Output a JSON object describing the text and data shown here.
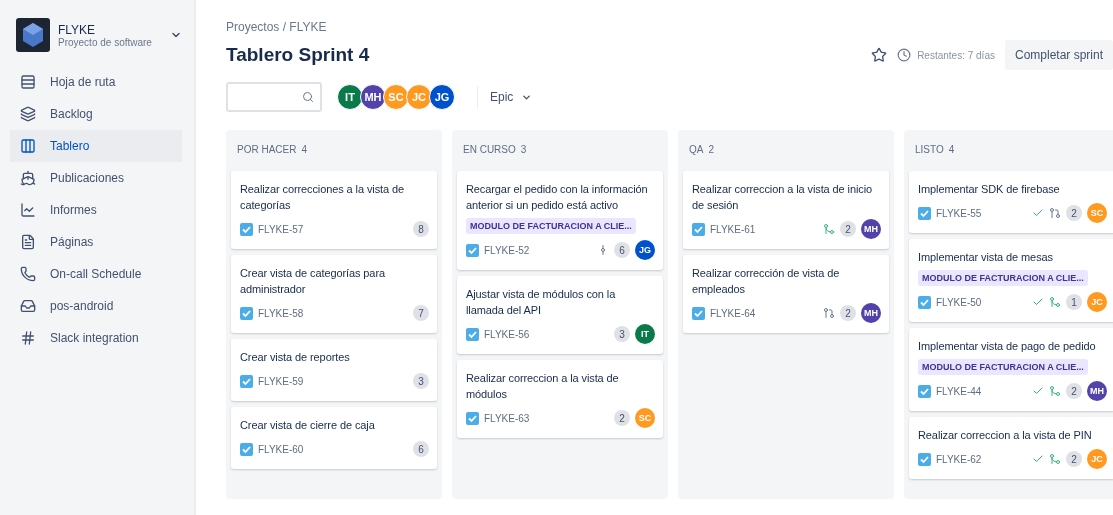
{
  "sidebar": {
    "project": {
      "name": "FLYKE",
      "type": "Proyecto de software"
    },
    "items": [
      {
        "label": "Hoja de ruta",
        "kind": "roadmap",
        "selected": false
      },
      {
        "label": "Backlog",
        "kind": "backlog",
        "selected": false
      },
      {
        "label": "Tablero",
        "kind": "board",
        "selected": true
      },
      {
        "label": "Publicaciones",
        "kind": "releases",
        "selected": false
      },
      {
        "label": "Informes",
        "kind": "reports",
        "selected": false
      },
      {
        "label": "Páginas",
        "kind": "pages",
        "selected": false
      },
      {
        "label": "On-call Schedule",
        "kind": "oncall",
        "selected": false
      },
      {
        "label": "pos-android",
        "kind": "repo",
        "selected": false
      },
      {
        "label": "Slack integration",
        "kind": "slack",
        "selected": false
      }
    ]
  },
  "header": {
    "breadcrumb": "Proyectos / FLYKE",
    "title": "Tablero Sprint 4",
    "remaining": "Restantes: 7 días",
    "complete_button": "Completar sprint"
  },
  "filters": {
    "avatars": [
      {
        "initials": "IT",
        "color": "#0b7a4b"
      },
      {
        "initials": "MH",
        "color": "#5243aa"
      },
      {
        "initials": "SC",
        "color": "#ff991f"
      },
      {
        "initials": "JC",
        "color": "#ff991f"
      },
      {
        "initials": "JG",
        "color": "#0052cc"
      }
    ],
    "epic_filter": "Epic"
  },
  "columns": [
    {
      "name": "POR HACER",
      "count": "4",
      "cards": [
        {
          "title": "Realizar correcciones a la vista de categorías",
          "key": "FLYKE-57",
          "estimate": "8"
        },
        {
          "title": "Crear vista de categorías para administrador",
          "key": "FLYKE-58",
          "estimate": "7"
        },
        {
          "title": "Crear vista de reportes",
          "key": "FLYKE-59",
          "estimate": "3"
        },
        {
          "title": "Crear vista de cierre de caja",
          "key": "FLYKE-60",
          "estimate": "6"
        }
      ]
    },
    {
      "name": "EN CURSO",
      "count": "3",
      "cards": [
        {
          "title": "Recargar el pedido con la información anterior si un pedido está activo",
          "epic": "MODULO DE FACTURACION A CLIE...",
          "key": "FLYKE-52",
          "badges": [
            {
              "kind": "commit"
            }
          ],
          "estimate": "6",
          "assignee": {
            "initials": "JG",
            "color": "#0052cc"
          }
        },
        {
          "title": "Ajustar vista de módulos con la llamada del API",
          "key": "FLYKE-56",
          "estimate": "3",
          "assignee": {
            "initials": "IT",
            "color": "#0b7a4b"
          }
        },
        {
          "title": "Realizar correccion a la vista de módulos",
          "key": "FLYKE-63",
          "estimate": "2",
          "assignee": {
            "initials": "SC",
            "color": "#ff991f"
          }
        }
      ]
    },
    {
      "name": "QA",
      "count": "2",
      "cards": [
        {
          "title": "Realizar correccion a la vista de inicio de sesión",
          "key": "FLYKE-61",
          "badges": [
            {
              "kind": "merged"
            }
          ],
          "estimate": "2",
          "assignee": {
            "initials": "MH",
            "color": "#5243aa"
          }
        },
        {
          "title": "Realizar corrección de vista de empleados",
          "key": "FLYKE-64",
          "badges": [
            {
              "kind": "open"
            }
          ],
          "estimate": "2",
          "assignee": {
            "initials": "MH",
            "color": "#5243aa"
          }
        }
      ]
    },
    {
      "name": "LISTO",
      "count": "4",
      "cards": [
        {
          "title": "Implementar SDK de firebase",
          "key": "FLYKE-55",
          "badges": [
            {
              "kind": "done"
            },
            {
              "kind": "open"
            }
          ],
          "estimate": "2",
          "assignee": {
            "initials": "SC",
            "color": "#ff991f"
          }
        },
        {
          "title": "Implementar vista de mesas",
          "epic": "MODULO DE FACTURACION A CLIE...",
          "key": "FLYKE-50",
          "badges": [
            {
              "kind": "done"
            },
            {
              "kind": "merged"
            }
          ],
          "estimate": "1",
          "assignee": {
            "initials": "JC",
            "color": "#ff991f"
          }
        },
        {
          "title": "Implementar vista de pago de pedido",
          "epic": "MODULO DE FACTURACION A CLIE...",
          "key": "FLYKE-44",
          "badges": [
            {
              "kind": "done"
            },
            {
              "kind": "merged"
            }
          ],
          "estimate": "2",
          "assignee": {
            "initials": "MH",
            "color": "#5243aa"
          }
        },
        {
          "title": "Realizar correccion a la vista de PIN",
          "key": "FLYKE-62",
          "badges": [
            {
              "kind": "done"
            },
            {
              "kind": "merged"
            }
          ],
          "estimate": "2",
          "assignee": {
            "initials": "JC",
            "color": "#ff991f"
          }
        }
      ]
    }
  ]
}
